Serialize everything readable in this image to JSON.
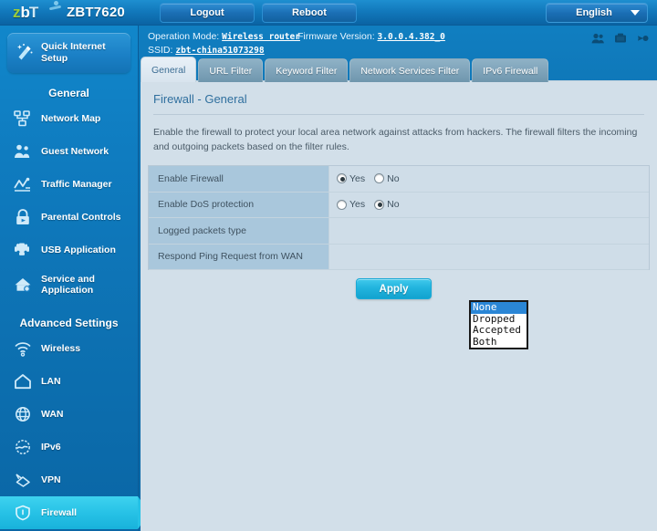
{
  "header": {
    "logo": {
      "z": "z",
      "b": "b",
      "t": "T"
    },
    "model": "ZBT7620",
    "logout_label": "Logout",
    "reboot_label": "Reboot",
    "language": "English"
  },
  "info": {
    "operation_mode_label": "Operation Mode:",
    "operation_mode_value": "Wireless router",
    "firmware_label": "Firmware Version:",
    "firmware_value": "3.0.0.4.382_0",
    "ssid_label": "SSID:",
    "ssid_value": "zbt-china51073298"
  },
  "tabs": [
    {
      "label": "General",
      "active": true
    },
    {
      "label": "URL Filter",
      "active": false
    },
    {
      "label": "Keyword Filter",
      "active": false
    },
    {
      "label": "Network Services Filter",
      "active": false
    },
    {
      "label": "IPv6 Firewall",
      "active": false
    }
  ],
  "sidebar": {
    "quick_setup": "Quick Internet Setup",
    "general_heading": "General",
    "general_items": [
      {
        "label": "Network Map",
        "icon": "network-map-icon"
      },
      {
        "label": "Guest Network",
        "icon": "guest-network-icon"
      },
      {
        "label": "Traffic Manager",
        "icon": "traffic-manager-icon"
      },
      {
        "label": "Parental Controls",
        "icon": "parental-controls-icon"
      },
      {
        "label": "USB Application",
        "icon": "usb-application-icon"
      },
      {
        "label": "Service and Application",
        "icon": "service-application-icon"
      }
    ],
    "advanced_heading": "Advanced Settings",
    "advanced_items": [
      {
        "label": "Wireless",
        "icon": "wireless-icon"
      },
      {
        "label": "LAN",
        "icon": "lan-icon"
      },
      {
        "label": "WAN",
        "icon": "wan-icon"
      },
      {
        "label": "IPv6",
        "icon": "ipv6-icon"
      },
      {
        "label": "VPN",
        "icon": "vpn-icon"
      },
      {
        "label": "Firewall",
        "icon": "firewall-icon"
      }
    ]
  },
  "main": {
    "title": "Firewall - General",
    "description": "Enable the firewall to protect your local area network against attacks from hackers. The firewall filters the incoming and outgoing packets based on the filter rules.",
    "rows": [
      {
        "label": "Enable Firewall",
        "type": "radio",
        "options": [
          "Yes",
          "No"
        ],
        "selected": "Yes"
      },
      {
        "label": "Enable DoS protection",
        "type": "radio",
        "options": [
          "Yes",
          "No"
        ],
        "selected": "No"
      },
      {
        "label": "Logged packets type",
        "type": "select",
        "selected": "None"
      },
      {
        "label": "Respond Ping Request from WAN",
        "type": "empty"
      }
    ],
    "logged_packets_options": [
      "None",
      "Dropped",
      "Accepted",
      "Both"
    ],
    "apply_label": "Apply"
  },
  "colors": {
    "brand_blue": "#0d71b2",
    "accent_cyan": "#27c2e6",
    "panel_bg": "#d2dfe9",
    "row_label_bg": "#a9c7dc",
    "title_text": "#2f6f9e",
    "select_highlight": "#2a86d6"
  }
}
